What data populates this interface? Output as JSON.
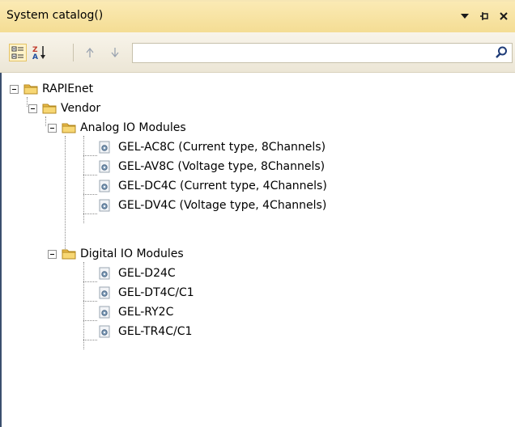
{
  "panel": {
    "title": "System catalog()"
  },
  "toolbar": {
    "search_value": ""
  },
  "tree": {
    "root": "RAPIEnet",
    "vendor": "Vendor",
    "groups": [
      {
        "label": "Analog IO Modules",
        "items": [
          "GEL-AC8C (Current type, 8Channels)",
          "GEL-AV8C (Voltage type, 8Channels)",
          "GEL-DC4C (Current type, 4Channels)",
          "GEL-DV4C (Voltage type, 4Channels)"
        ]
      },
      {
        "label": "Digital IO Modules",
        "items": [
          "GEL-D24C",
          "GEL-DT4C/C1",
          "GEL-RY2C",
          "GEL-TR4C/C1"
        ]
      }
    ]
  }
}
